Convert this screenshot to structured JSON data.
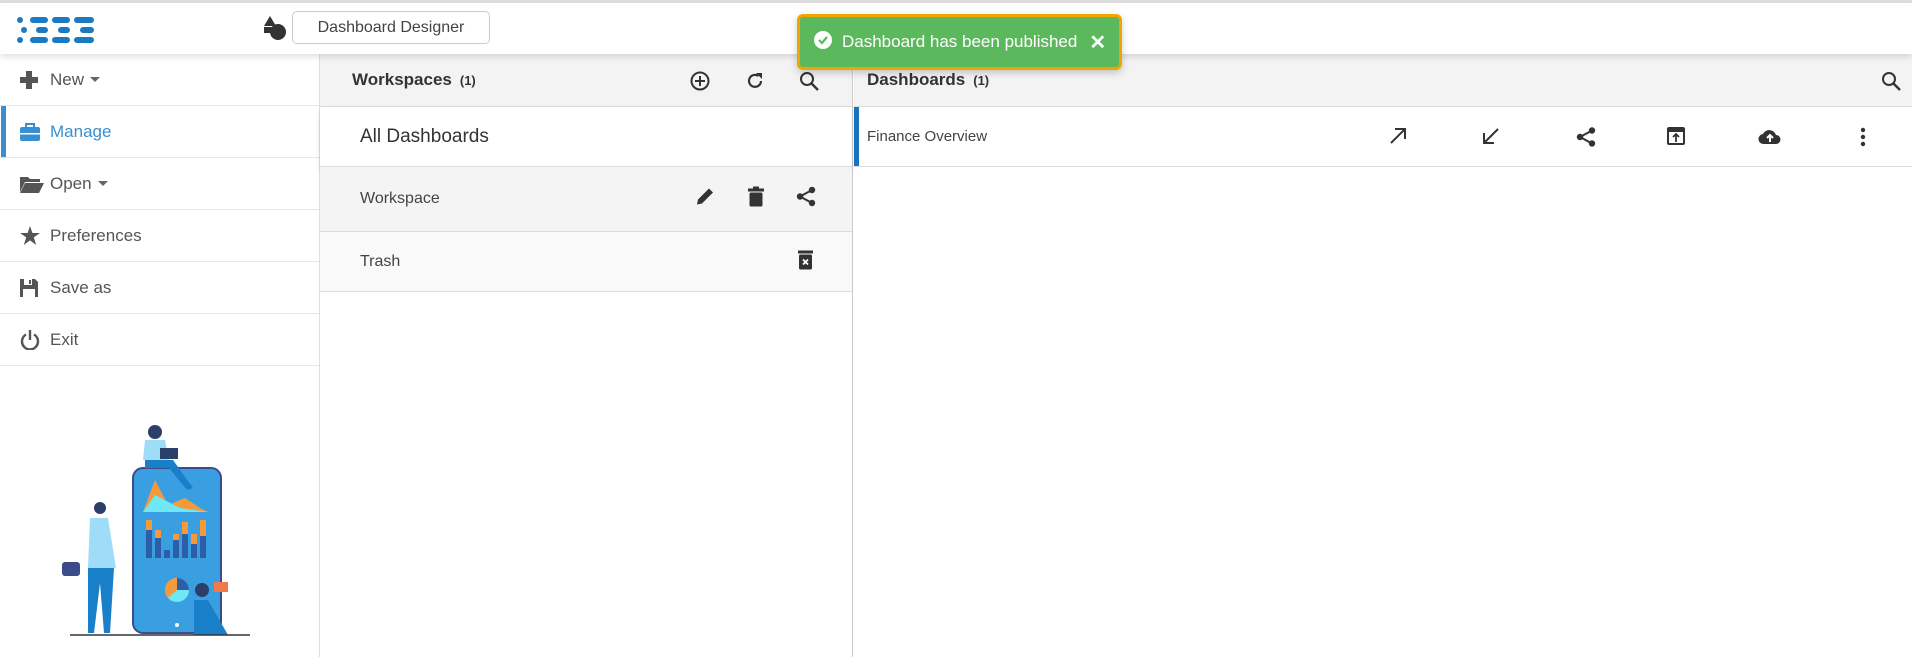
{
  "header": {
    "app_button": "Dashboard Designer"
  },
  "toast": {
    "message": "Dashboard has been published",
    "close": "✕"
  },
  "sidebar": {
    "items": [
      {
        "label": "New"
      },
      {
        "label": "Manage"
      },
      {
        "label": "Open"
      },
      {
        "label": "Preferences"
      },
      {
        "label": "Save as"
      },
      {
        "label": "Exit"
      }
    ]
  },
  "workspaces": {
    "title": "Workspaces",
    "count": "(1)",
    "all": "All Dashboards",
    "items": [
      {
        "label": "Workspace"
      },
      {
        "label": "Trash"
      }
    ]
  },
  "dashboards": {
    "title": "Dashboards",
    "count": "(1)",
    "items": [
      {
        "label": "Finance Overview"
      }
    ]
  },
  "colors": {
    "accent": "#3a8fd0",
    "toast_bg": "#5cb85c",
    "toast_border": "#f0a500"
  }
}
